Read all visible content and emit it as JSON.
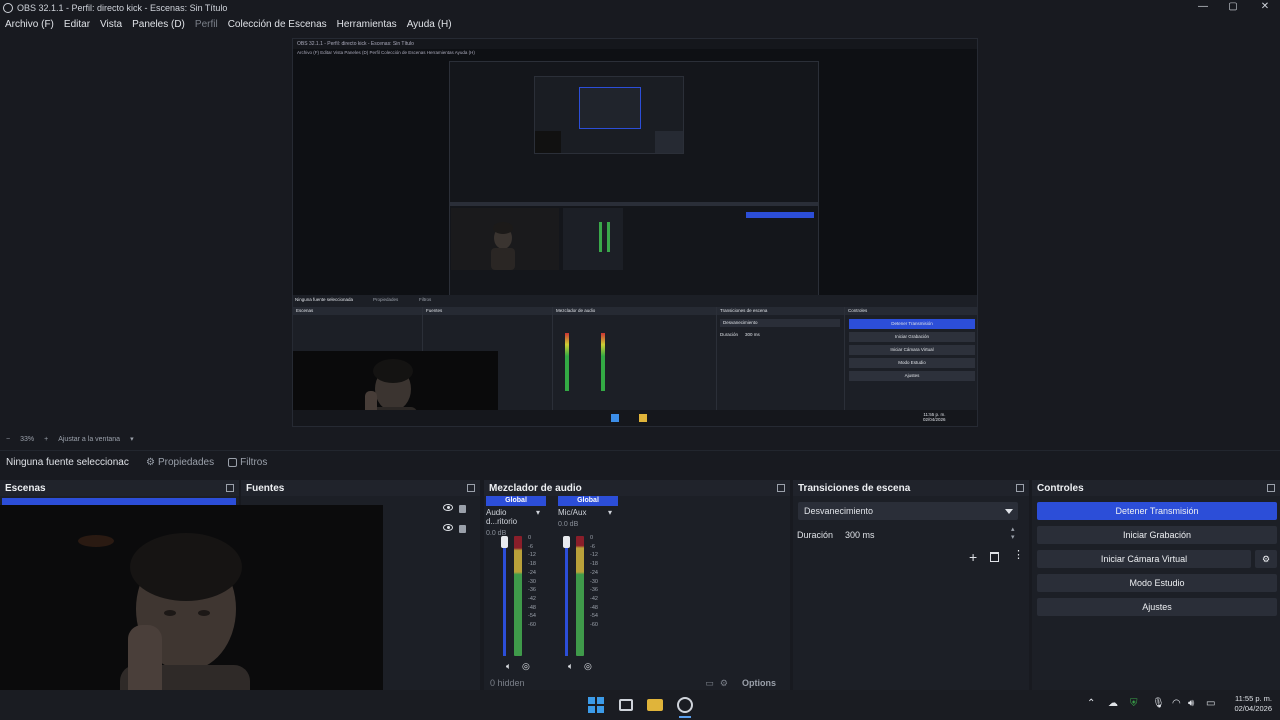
{
  "window": {
    "title": "OBS 32.1.1 - Perfil: directo kick - Escenas: Sin Título",
    "minimize": "—",
    "maximize": "▢",
    "close": "✕"
  },
  "menu": {
    "items": [
      "Archivo (F)",
      "Editar",
      "Vista",
      "Paneles (D)",
      "Perfil",
      "Colección de Escenas",
      "Herramientas",
      "Ayuda (H)"
    ]
  },
  "preview_nested": {
    "title": "OBS 32.1.1 - Perfil: directo kick - Escenas: Sin Título",
    "menu": "Archivo (F)   Editar   Vista   Paneles (D)   Perfil   Colección de Escenas   Herramientas   Ayuda (H)",
    "no_source": "Ninguna fuente seleccionada",
    "props": "Propiedades",
    "filters": "Filtros",
    "docks": [
      "Escenas",
      "Fuentes",
      "Mezclador de audio",
      "Transiciones de escena",
      "Controles"
    ],
    "buttons": [
      "Detener Transmisión",
      "Iniciar Grabación",
      "Iniciar Cámara Virtual",
      "Modo Estudio",
      "Ajustes"
    ],
    "transition": "Desvanecimiento",
    "duration_label": "Duración",
    "duration": "300 ms",
    "time": "11:55 p. m.",
    "date": "02/04/2026"
  },
  "zoom_bar": {
    "minus": "−",
    "zoom": "33%",
    "plus": "+",
    "fit": "Ajustar a la ventana"
  },
  "toolbar": {
    "no_source": "Ninguna fuente seleccionac",
    "properties": "Propiedades",
    "filters": "Filtros"
  },
  "scenes": {
    "title": "Escenas"
  },
  "sources": {
    "title": "Fuentes"
  },
  "mixer": {
    "title": "Mezclador de audio",
    "channels": [
      {
        "tab": "Global",
        "name": "Audio d...ritorio",
        "db": "0.0 dB"
      },
      {
        "tab": "Global",
        "name": "Mic/Aux",
        "db": "0.0 dB"
      }
    ],
    "scale": [
      "0",
      "-6",
      "-12",
      "-18",
      "-24",
      "-30",
      "-36",
      "-42",
      "-48",
      "-54",
      "-60"
    ],
    "hidden": "0 hidden",
    "options": "Options"
  },
  "transitions": {
    "title": "Transiciones de escena",
    "selected": "Desvanecimiento",
    "duration_label": "Duración",
    "duration": "300 ms"
  },
  "controls": {
    "title": "Controles",
    "stop_stream": "Detener Transmisión",
    "start_recording": "Iniciar Grabación",
    "start_virtualcam": "Iniciar Cámara Virtual",
    "studio_mode": "Modo Estudio",
    "settings": "Ajustes"
  },
  "tray": {
    "time": "11:55 p. m.",
    "date": "02/04/2026"
  },
  "colors": {
    "accent": "#2c4ed8",
    "background": "#181a20",
    "dock": "#1c1f26"
  }
}
